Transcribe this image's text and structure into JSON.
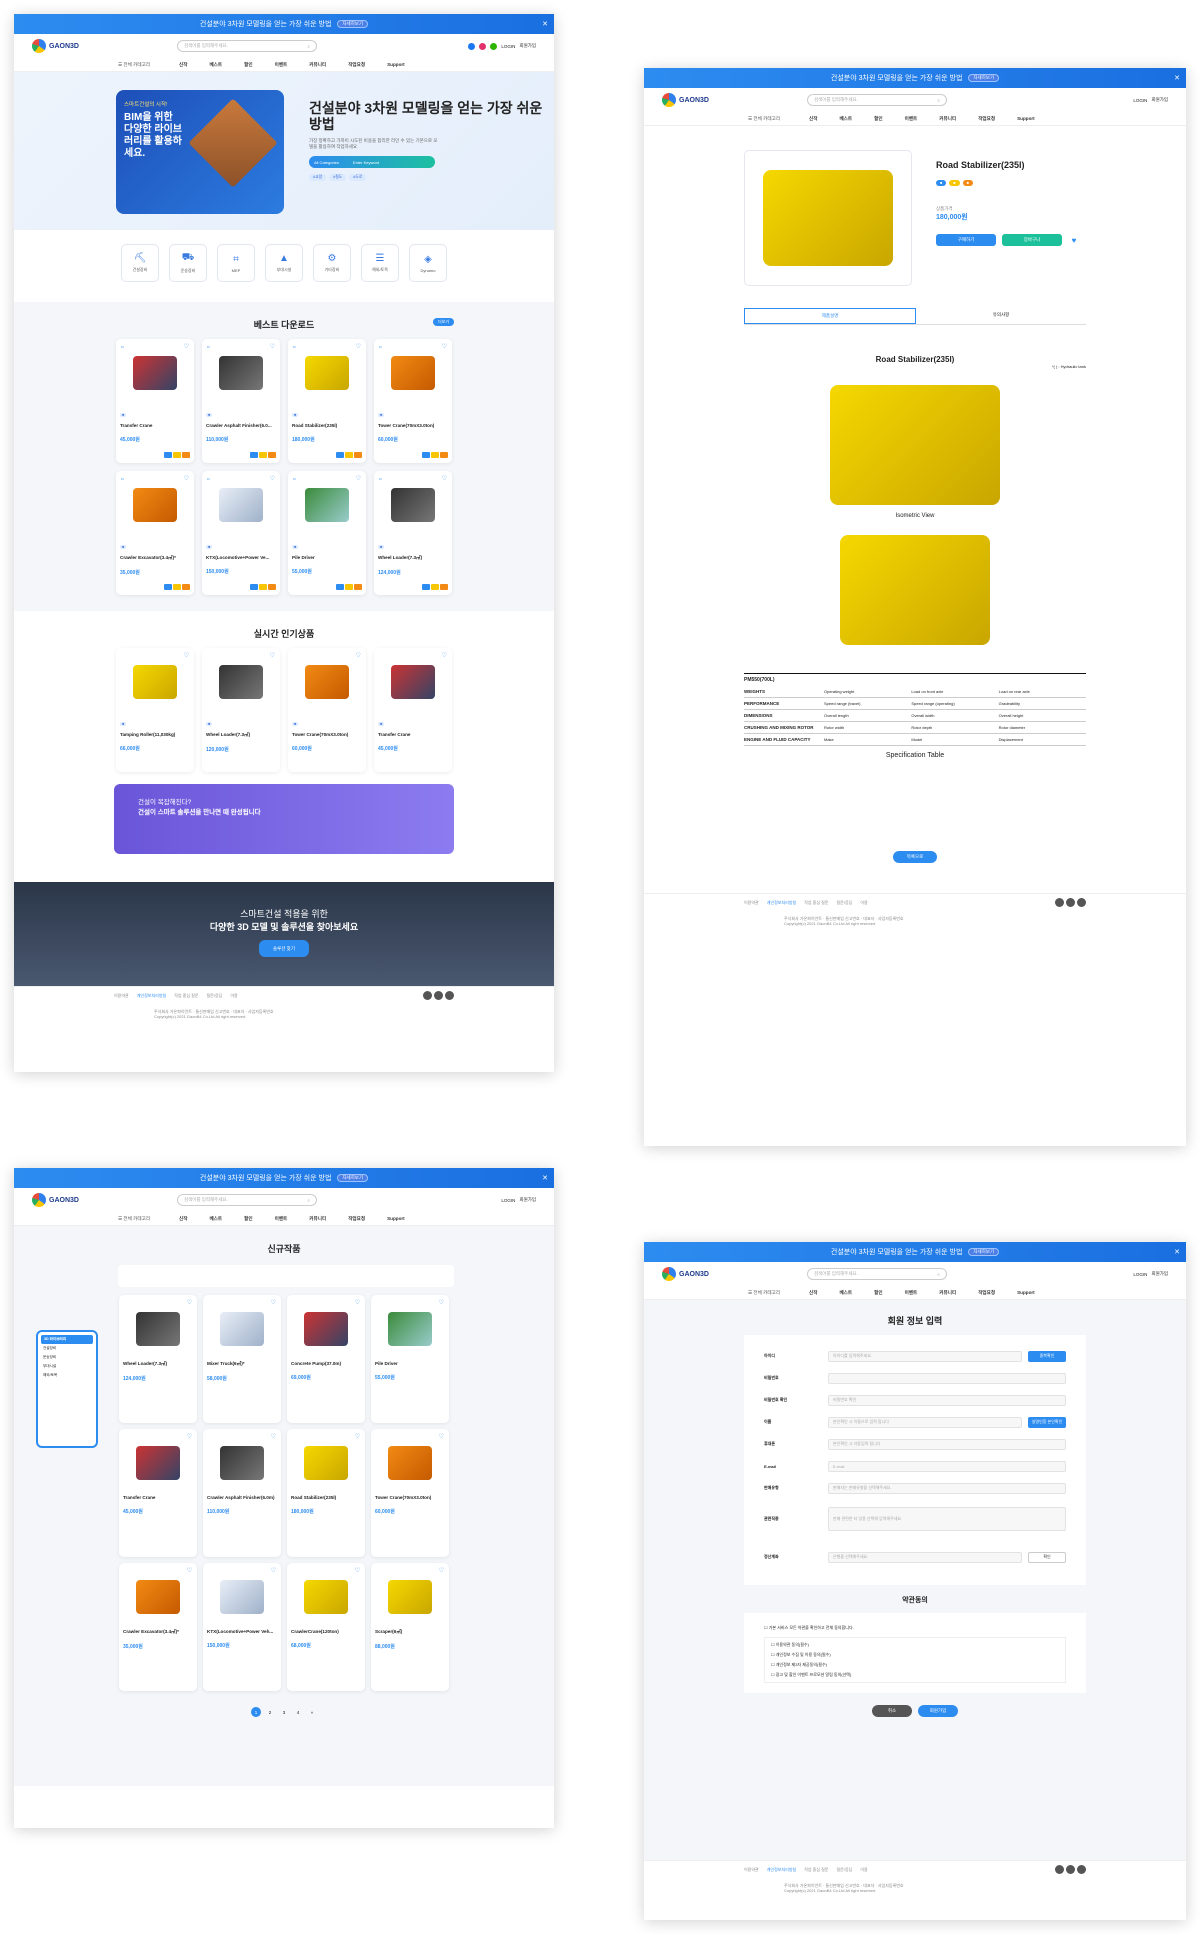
{
  "banner": {
    "text": "건설분야 3차원 모델링을 얻는 가장 쉬운 방법",
    "badge": "자세히보기"
  },
  "header": {
    "logo": "GAON3D",
    "search_placeholder": "검색어를 입력해주세요.",
    "login": "LOGIN",
    "join": "회원가입"
  },
  "nav": {
    "category": "전체 카테고리",
    "items": [
      "신작",
      "베스트",
      "할인",
      "이벤트",
      "커뮤니티",
      "작업요청",
      "Support"
    ]
  },
  "hero": {
    "box_small": "스마트건설의 시작!",
    "box_big": "BIM을 위한 다양한 라이브러리를 활용하세요.",
    "title": "건설분야 3차원 모델링을 얻는 가장 쉬운 방법",
    "desc": "가장 정확하고 가까이 시도된 비용을 합리한 라인 수 있는 기본으로 모델을 활용하여 작업하세요",
    "search_cat": "All Categories",
    "search_kw": "Enter Keyword",
    "tags": [
      "#교량",
      "#철도",
      "#도로"
    ]
  },
  "categories": [
    "건설장비",
    "운송장비",
    "MEP",
    "부대시설",
    "기타장비",
    "해외/토목",
    "Dynamo"
  ],
  "best": {
    "title": "베스트 다운로드",
    "more": "더보기",
    "items": [
      {
        "name": "Transfer Crane",
        "price": "45,000원"
      },
      {
        "name": "Crawler Asphalt Finisher(6.0...",
        "price": "110,000원"
      },
      {
        "name": "Road Stabilizer(235l)",
        "price": "180,000원"
      },
      {
        "name": "Tower Crane(70mX3.0ton)",
        "price": "60,000원"
      },
      {
        "name": "Crawler Excavator(3.4㎥)*",
        "price": "35,000원"
      },
      {
        "name": "KTX(Locomotive+Power Ve...",
        "price": "150,000원"
      },
      {
        "name": "Pile Driver",
        "price": "55,000원"
      },
      {
        "name": "Wheel Loader(7.3㎥)",
        "price": "124,000원"
      }
    ]
  },
  "popular": {
    "title": "실시간 인기상품",
    "items": [
      {
        "name": "Tamping Roller(11,030kg)",
        "price": "66,000원"
      },
      {
        "name": "Wheel Loader(7.3㎥)",
        "price": "120,000원"
      },
      {
        "name": "Tower Crane(70mX3.0ton)",
        "price": "60,000원"
      },
      {
        "name": "Transfer Crane",
        "price": "45,000원"
      }
    ]
  },
  "promo": {
    "l1": "건설이 복잡해진다?",
    "l2": "건설이 스마트 솔루션을 만나면 때 완성됩니다"
  },
  "photo": {
    "l1": "스마트건설 적용을 위한",
    "l2": "다양한 3D 모델 및 솔루션을 찾아보세요",
    "btn": "솔루션 찾기"
  },
  "footer": {
    "links": [
      "이용약관",
      "개인정보처리방침",
      "작업 중심 질문",
      "질문/응답",
      "이용"
    ],
    "addr": "주식회사 가온파이언트 · 통신판매업 신고번호 · 대표자 · 사업자등록번호",
    "copy": "Copyright(c) 2021 GaonB4 Co.Ltd All right reserved"
  },
  "detail": {
    "title": "Road Stabilizer(235l)",
    "price_label": "상품가격",
    "price": "180,000원",
    "buy": "구매하기",
    "cart": "장바구니",
    "tabs": [
      "제품설명",
      "유의사항"
    ],
    "iso": "Isometric View",
    "spec_label": "Specification Table",
    "model": "PM550(700L)",
    "note": "*( ) : Hydraulic tank",
    "spec": [
      {
        "g": "WEIGHTS",
        "c": [
          "Operating weight",
          "Load on front axle",
          "Load on rear axle"
        ]
      },
      {
        "g": "PERFORMANCE",
        "c": [
          "Speed range (travel)",
          "Speed range (operating)",
          "Gradeability"
        ]
      },
      {
        "g": "DIMENSIONS",
        "c": [
          "Overall length",
          "Overall width",
          "Overall height"
        ]
      },
      {
        "g": "CRUSHING AND MIXING ROTOR",
        "c": [
          "Rotor width",
          "Rotor depth",
          "Rotor diameter"
        ]
      },
      {
        "g": "ENGINE AND FLUID CAPACITY",
        "c": [
          "Make",
          "Model",
          "Displacement"
        ]
      }
    ],
    "list_btn": "목록으로"
  },
  "newlist": {
    "title": "신규작품",
    "sidebar_h": "3D 라이브러리",
    "sidebar_items": [
      "건설장비",
      "운송장비",
      "부대시설",
      "해외/토목"
    ],
    "items": [
      {
        "name": "Wheel Loader(7.3㎥)",
        "price": "124,000원"
      },
      {
        "name": "Mixer Truck(6㎥)*",
        "price": "58,000원"
      },
      {
        "name": "Concrete Pump(37.0m)",
        "price": "69,000원"
      },
      {
        "name": "Pile Driver",
        "price": "55,000원"
      },
      {
        "name": "Transfer Crane",
        "price": "45,000원"
      },
      {
        "name": "Crawler Asphalt Finisher(6.0m)",
        "price": "110,000원"
      },
      {
        "name": "Road Stabilizer(235l)",
        "price": "180,000원"
      },
      {
        "name": "Tower Crane(70mX3.0ton)",
        "price": "60,000원"
      },
      {
        "name": "Crawler Excavator(3.4㎥)*",
        "price": "35,000원"
      },
      {
        "name": "KTX(Locomotive+Power Veh...",
        "price": "150,000원"
      },
      {
        "name": "CrawlerCrane(120ton)",
        "price": "68,000원"
      },
      {
        "name": "Scraper(6㎥)",
        "price": "88,000원"
      }
    ],
    "pages": [
      "1",
      "2",
      "3",
      "4",
      "»"
    ]
  },
  "join": {
    "title": "회원 정보 입력",
    "fields": [
      {
        "label": "아이디",
        "ph": "아이디를 입력해주세요.",
        "btn": "중복확인"
      },
      {
        "label": "비밀번호",
        "ph": "",
        "btn": ""
      },
      {
        "label": "비밀번호 확인",
        "ph": "비밀번호 확인",
        "btn": ""
      },
      {
        "label": "이름",
        "ph": "본인확인 시 이름으로 입력 됩니다",
        "btn": "실명인증 본인확인"
      },
      {
        "label": "휴대폰",
        "ph": "본인확인 시 자동입력 됩니다",
        "btn": ""
      },
      {
        "label": "E-mail",
        "ph": "E-mail",
        "btn": ""
      },
      {
        "label": "판매유형",
        "ph": "판매자는 판매유형을 선택해주세요.",
        "btn": ""
      },
      {
        "label": "관련직종",
        "ph": "판매 관련한 타 업종 선택해 입력해주세요.",
        "btn": ""
      },
      {
        "label": "정산계좌",
        "ph": "은행을 선택해주세요.",
        "btn": "확인"
      }
    ],
    "terms_title": "약관동의",
    "terms": [
      "가본 서비스 모든 약관을 확인하고 전체 동의합니다.",
      "이용약관 동의(필수)",
      "개인정보 수집 및 이용 동의(필수)",
      "개인정보 제3자 제공동의(필수)",
      "광고 및 할인 이벤트 프로모션 알림 동의(선택)"
    ],
    "cancel": "취소",
    "submit": "회원가입"
  }
}
